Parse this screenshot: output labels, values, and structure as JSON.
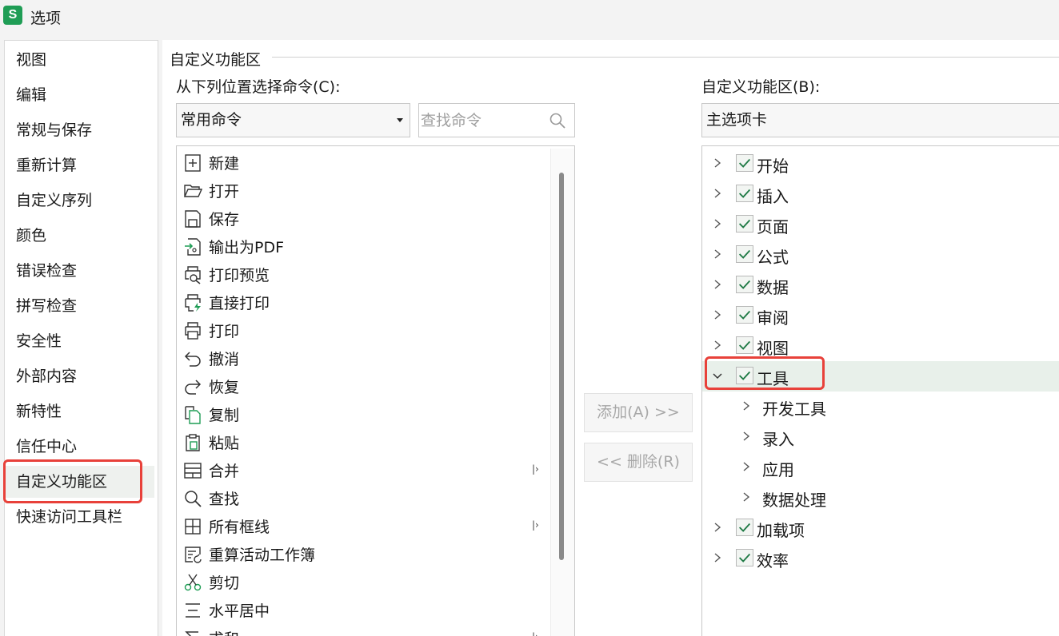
{
  "window": {
    "app_icon_letter": "S",
    "title": "选项"
  },
  "nav": {
    "items": [
      "视图",
      "编辑",
      "常规与保存",
      "重新计算",
      "自定义序列",
      "颜色",
      "错误检查",
      "拼写检查",
      "安全性",
      "外部内容",
      "新特性",
      "信任中心",
      "自定义功能区",
      "快速访问工具栏"
    ],
    "active": "自定义功能区"
  },
  "section": {
    "title": "自定义功能区"
  },
  "left": {
    "choose_label": "从下列位置选择命令(C):",
    "source_value": "常用命令",
    "search_placeholder": "查找命令",
    "commands": [
      {
        "label": "新建",
        "icon": "new-file-icon"
      },
      {
        "label": "打开",
        "icon": "open-folder-icon"
      },
      {
        "label": "保存",
        "icon": "save-icon"
      },
      {
        "label": "输出为PDF",
        "icon": "export-pdf-icon"
      },
      {
        "label": "打印预览",
        "icon": "print-preview-icon"
      },
      {
        "label": "直接打印",
        "icon": "quick-print-icon"
      },
      {
        "label": "打印",
        "icon": "print-icon"
      },
      {
        "label": "撤消",
        "icon": "undo-icon"
      },
      {
        "label": "恢复",
        "icon": "redo-icon"
      },
      {
        "label": "复制",
        "icon": "copy-icon"
      },
      {
        "label": "粘贴",
        "icon": "paste-icon",
        "submenu": false
      },
      {
        "label": "合并",
        "icon": "merge-icon",
        "submenu": true
      },
      {
        "label": "查找",
        "icon": "find-icon"
      },
      {
        "label": "所有框线",
        "icon": "all-borders-icon",
        "submenu": true
      },
      {
        "label": "重算活动工作簿",
        "icon": "recalc-icon"
      },
      {
        "label": "剪切",
        "icon": "cut-icon"
      },
      {
        "label": "水平居中",
        "icon": "align-center-icon"
      },
      {
        "label": "求和",
        "icon": "sum-icon",
        "submenu": true
      }
    ]
  },
  "buttons": {
    "add": "添加(A) >>",
    "remove": "<< 删除(R)"
  },
  "right": {
    "customize_label": "自定义功能区(B):",
    "scope_value": "主选项卡",
    "tabs": [
      {
        "label": "开始",
        "checked": true,
        "expanded": false
      },
      {
        "label": "插入",
        "checked": true,
        "expanded": false
      },
      {
        "label": "页面",
        "checked": true,
        "expanded": false
      },
      {
        "label": "公式",
        "checked": true,
        "expanded": false
      },
      {
        "label": "数据",
        "checked": true,
        "expanded": false
      },
      {
        "label": "审阅",
        "checked": true,
        "expanded": false
      },
      {
        "label": "视图",
        "checked": true,
        "expanded": false
      },
      {
        "label": "工具",
        "checked": true,
        "expanded": true,
        "children": [
          "开发工具",
          "录入",
          "应用",
          "数据处理"
        ]
      },
      {
        "label": "加载项",
        "checked": true,
        "expanded": false
      },
      {
        "label": "效率",
        "checked": true,
        "expanded": false
      }
    ]
  },
  "colors": {
    "accent_green": "#1f9d55",
    "highlight_red": "#e8413a",
    "selection_bg": "#e8f0ea"
  }
}
